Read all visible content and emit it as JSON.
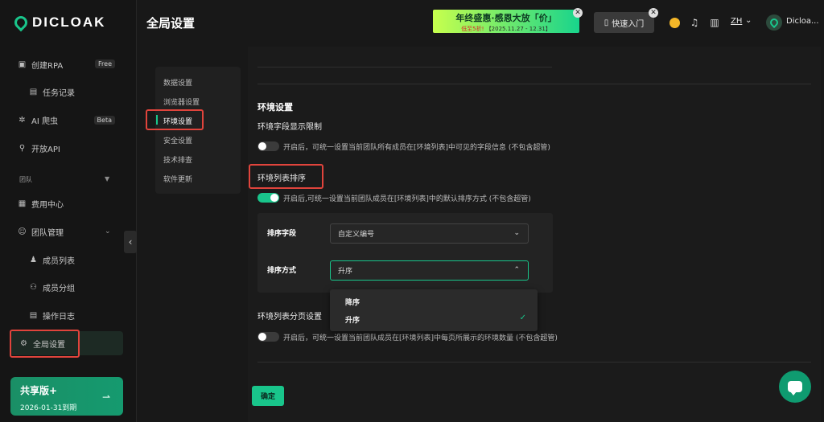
{
  "brand": {
    "name": "DICLOAK"
  },
  "colors": {
    "accent": "#19c58b",
    "highlight_box": "#e0443c",
    "background": "#181818"
  },
  "sidebar": {
    "items": [
      {
        "label": "创建RPA",
        "icon": "rpa-icon",
        "tag": "Free"
      },
      {
        "label": "任务记录",
        "icon": "document-icon"
      },
      {
        "label": "AI 爬虫",
        "icon": "crawler-icon",
        "tag": "Beta"
      },
      {
        "label": "开放API",
        "icon": "api-icon"
      }
    ],
    "section_title": "团队",
    "team_items": [
      {
        "label": "费用中心",
        "icon": "billing-icon"
      },
      {
        "label": "团队管理",
        "icon": "team-icon"
      }
    ],
    "team_sub_items": [
      {
        "label": "成员列表",
        "icon": "member-icon"
      },
      {
        "label": "成员分组",
        "icon": "group-icon"
      },
      {
        "label": "操作日志",
        "icon": "log-icon"
      }
    ],
    "global_settings": {
      "label": "全局设置",
      "icon": "gear-icon"
    },
    "plan": {
      "name": "共享版+",
      "expiry": "2026-01-31到期"
    }
  },
  "header": {
    "title": "全局设置",
    "promo": {
      "main": "年终盛惠·感恩大放「价」",
      "discount": "低至5折!",
      "period": "【2025.11.27 - 12.31】"
    },
    "quick_entry": "快速入门",
    "lang": "ZH",
    "user": "Dicloa..."
  },
  "subnav": {
    "items": [
      "数据设置",
      "浏览器设置",
      "环境设置",
      "安全设置",
      "技术排查",
      "软件更新"
    ],
    "active_index": 2
  },
  "settings": {
    "section_title": "环境设置",
    "field_limit": {
      "label": "环境字段显示限制",
      "enabled": false,
      "description": "开启后，可统一设置当前团队所有成员在[环境列表]中可见的字段信息 (不包含超管)"
    },
    "list_sort": {
      "label": "环境列表排序",
      "enabled": true,
      "description": "开启后,可统一设置当前团队成员在[环境列表]中的默认排序方式 (不包含超管)",
      "sort_field_label": "排序字段",
      "sort_field_value": "自定义编号",
      "sort_order_label": "排序方式",
      "sort_order_value": "升序",
      "sort_order_options": [
        "降序",
        "升序"
      ]
    },
    "pagination": {
      "label": "环境列表分页设置",
      "enabled": false,
      "description": "开启后，可统一设置当前团队成员在[环境列表]中每页所展示的环境数量 (不包含超管)"
    },
    "confirm_label": "确定"
  }
}
